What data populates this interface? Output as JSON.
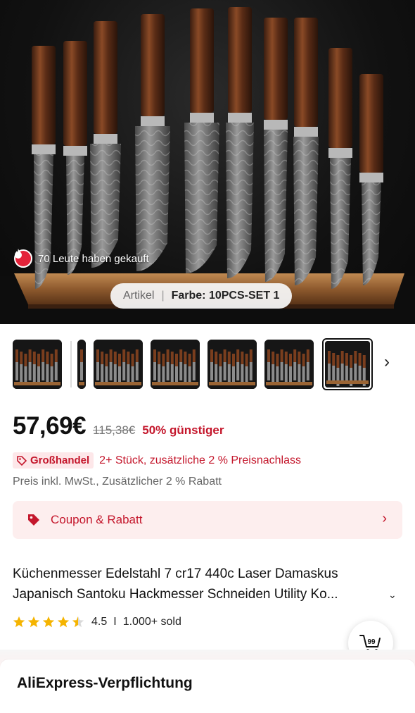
{
  "hero": {
    "sold_text": "70 Leute haben gekauft",
    "variant_label": "Artikel",
    "variant_value": "Farbe: 10PCS-SET 1"
  },
  "thumbnails": {
    "count": 7,
    "selected_index": 6
  },
  "price": {
    "current": "57,69€",
    "original": "115,38€",
    "discount": "50% günstiger"
  },
  "wholesale": {
    "badge": "Großhandel",
    "text": "2+ Stück, zusätzliche 2 % Preisnachlass"
  },
  "tax_note": "Preis inkl. MwSt., Zusätzlicher 2 % Rabatt",
  "coupon": {
    "label": "Coupon & Rabatt"
  },
  "product": {
    "title_line1": "Küchenmesser Edelstahl 7 cr17 440c Laser Damaskus",
    "title_line2": "Japanisch Santoku Hackmesser Schneiden Utility Ko..."
  },
  "rating": {
    "value": "4.5",
    "separator": "I",
    "sold": "1.000+ sold",
    "stars": 4.5
  },
  "cart_badge": "99",
  "commitment": {
    "title": "AliExpress-Verpflichtung"
  },
  "colors": {
    "accent_red": "#c4172c",
    "coupon_bg": "#fdeeee",
    "star": "#f5b400"
  }
}
